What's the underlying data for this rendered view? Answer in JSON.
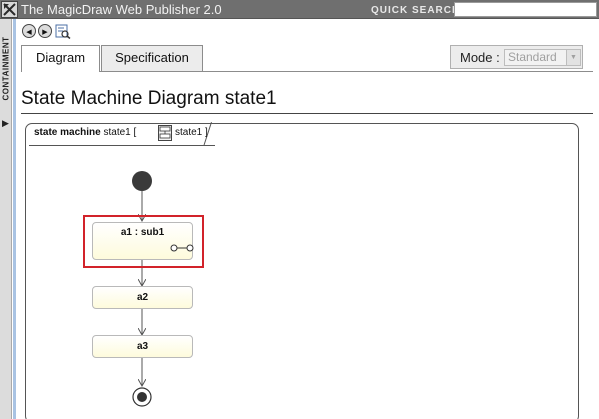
{
  "app": {
    "title": "The MagicDraw Web Publisher 2.0"
  },
  "quick_search": {
    "label": "QUICK SEARCH:",
    "value": ""
  },
  "side_panel": {
    "label": "CONTAINMENT"
  },
  "toolbar": {
    "back_glyph": "◀",
    "forward_glyph": "▶",
    "icons": [
      "back-icon",
      "forward-icon",
      "find-icon"
    ]
  },
  "tabs": [
    {
      "label": "Diagram",
      "active": true
    },
    {
      "label": "Specification",
      "active": false
    }
  ],
  "mode": {
    "label": "Mode :",
    "selected": "Standard"
  },
  "page": {
    "title": "State Machine Diagram state1"
  },
  "diagram": {
    "frame_keyword": "state machine",
    "frame_name": "state1 [",
    "frame_ref": "state1 ]",
    "states": [
      {
        "name": "a1 : sub1",
        "selected": true
      },
      {
        "name": "a2",
        "selected": false
      },
      {
        "name": "a3",
        "selected": false
      }
    ],
    "colors": {
      "selection": "#d2232a",
      "state_fill": "#fefbdc"
    }
  }
}
